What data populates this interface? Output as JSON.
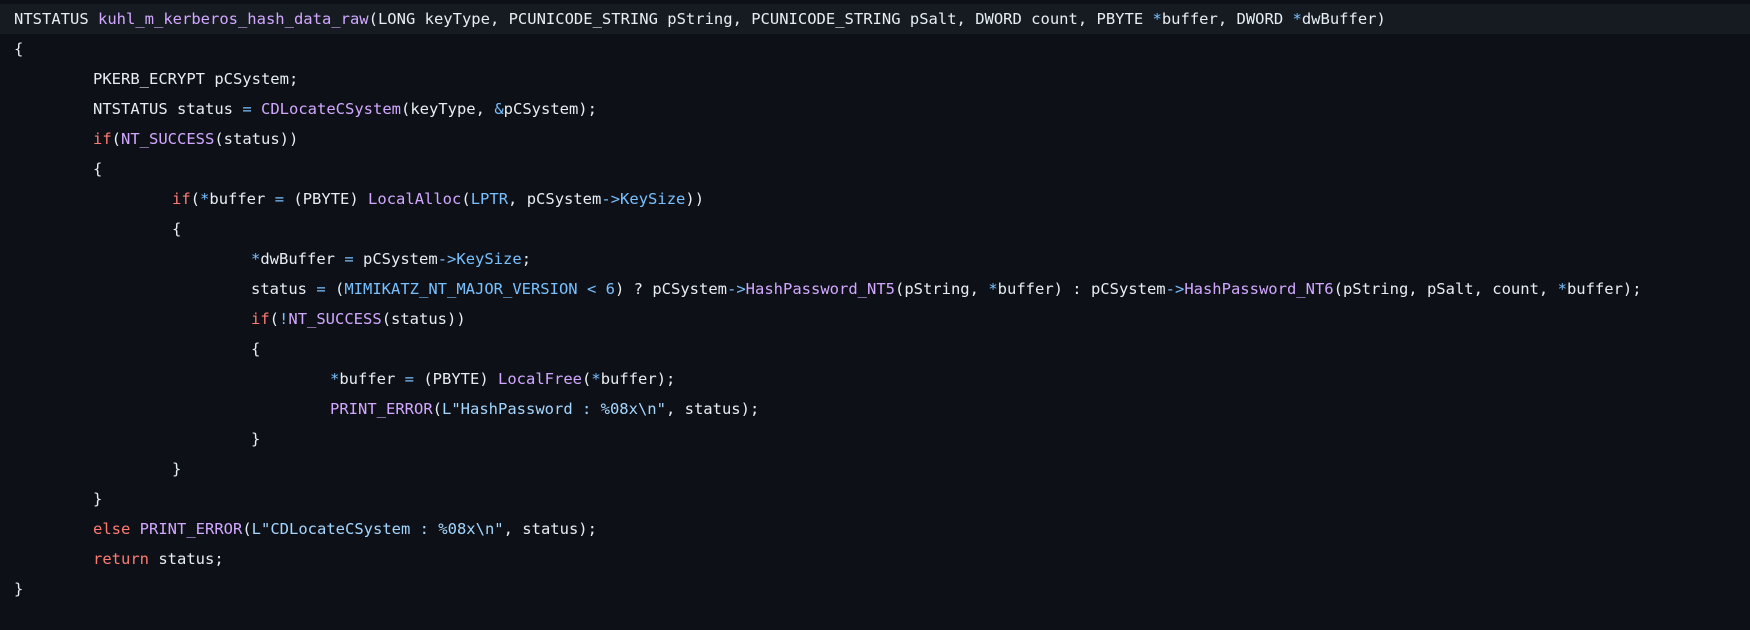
{
  "colors": {
    "background": "#0d1117",
    "highlight_line": "#161b22",
    "plain": "#e6edf3",
    "function": "#d2a8ff",
    "keyword": "#ff7b72",
    "operator": "#79c0ff",
    "constant": "#79c0ff",
    "string": "#a5d6ff",
    "member": "#79c0ff"
  },
  "code": {
    "lines": [
      {
        "indent": 0,
        "highlight": true,
        "tokens": [
          {
            "t": "NTSTATUS ",
            "c": "plain"
          },
          {
            "t": "kuhl_m_kerberos_hash_data_raw",
            "c": "function"
          },
          {
            "t": "(LONG keyType, PCUNICODE_STRING pString, PCUNICODE_STRING pSalt, DWORD count, PBYTE ",
            "c": "plain"
          },
          {
            "t": "*",
            "c": "operator"
          },
          {
            "t": "buffer, DWORD ",
            "c": "plain"
          },
          {
            "t": "*",
            "c": "operator"
          },
          {
            "t": "dwBuffer)",
            "c": "plain"
          }
        ]
      },
      {
        "indent": 0,
        "tokens": [
          {
            "t": "{",
            "c": "plain"
          }
        ]
      },
      {
        "indent": 1,
        "tokens": [
          {
            "t": "PKERB_ECRYPT pCSystem;",
            "c": "plain"
          }
        ]
      },
      {
        "indent": 1,
        "tokens": [
          {
            "t": "NTSTATUS status ",
            "c": "plain"
          },
          {
            "t": "=",
            "c": "operator"
          },
          {
            "t": " ",
            "c": "plain"
          },
          {
            "t": "CDLocateCSystem",
            "c": "function"
          },
          {
            "t": "(keyType, ",
            "c": "plain"
          },
          {
            "t": "&",
            "c": "operator"
          },
          {
            "t": "pCSystem);",
            "c": "plain"
          }
        ]
      },
      {
        "indent": 1,
        "tokens": [
          {
            "t": "if",
            "c": "keyword"
          },
          {
            "t": "(",
            "c": "plain"
          },
          {
            "t": "NT_SUCCESS",
            "c": "function"
          },
          {
            "t": "(status))",
            "c": "plain"
          }
        ]
      },
      {
        "indent": 1,
        "tokens": [
          {
            "t": "{",
            "c": "plain"
          }
        ]
      },
      {
        "indent": 2,
        "tokens": [
          {
            "t": "if",
            "c": "keyword"
          },
          {
            "t": "(",
            "c": "plain"
          },
          {
            "t": "*",
            "c": "operator"
          },
          {
            "t": "buffer ",
            "c": "plain"
          },
          {
            "t": "=",
            "c": "operator"
          },
          {
            "t": " (PBYTE) ",
            "c": "plain"
          },
          {
            "t": "LocalAlloc",
            "c": "function"
          },
          {
            "t": "(",
            "c": "plain"
          },
          {
            "t": "LPTR",
            "c": "const"
          },
          {
            "t": ", pCSystem",
            "c": "plain"
          },
          {
            "t": "->",
            "c": "operator"
          },
          {
            "t": "KeySize",
            "c": "member"
          },
          {
            "t": "))",
            "c": "plain"
          }
        ]
      },
      {
        "indent": 2,
        "tokens": [
          {
            "t": "{",
            "c": "plain"
          }
        ]
      },
      {
        "indent": 3,
        "tokens": [
          {
            "t": "*",
            "c": "operator"
          },
          {
            "t": "dwBuffer ",
            "c": "plain"
          },
          {
            "t": "=",
            "c": "operator"
          },
          {
            "t": " pCSystem",
            "c": "plain"
          },
          {
            "t": "->",
            "c": "operator"
          },
          {
            "t": "KeySize",
            "c": "member"
          },
          {
            "t": ";",
            "c": "plain"
          }
        ]
      },
      {
        "indent": 3,
        "tokens": [
          {
            "t": "status ",
            "c": "plain"
          },
          {
            "t": "=",
            "c": "operator"
          },
          {
            "t": " (",
            "c": "plain"
          },
          {
            "t": "MIMIKATZ_NT_MAJOR_VERSION",
            "c": "const"
          },
          {
            "t": " ",
            "c": "plain"
          },
          {
            "t": "<",
            "c": "operator"
          },
          {
            "t": " ",
            "c": "plain"
          },
          {
            "t": "6",
            "c": "const"
          },
          {
            "t": ") ? pCSystem",
            "c": "plain"
          },
          {
            "t": "->",
            "c": "operator"
          },
          {
            "t": "HashPassword_NT5",
            "c": "function"
          },
          {
            "t": "(pString, ",
            "c": "plain"
          },
          {
            "t": "*",
            "c": "operator"
          },
          {
            "t": "buffer) : pCSystem",
            "c": "plain"
          },
          {
            "t": "->",
            "c": "operator"
          },
          {
            "t": "HashPassword_NT6",
            "c": "function"
          },
          {
            "t": "(pString, pSalt, count, ",
            "c": "plain"
          },
          {
            "t": "*",
            "c": "operator"
          },
          {
            "t": "buffer);",
            "c": "plain"
          }
        ]
      },
      {
        "indent": 3,
        "tokens": [
          {
            "t": "if",
            "c": "keyword"
          },
          {
            "t": "(",
            "c": "plain"
          },
          {
            "t": "!",
            "c": "operator"
          },
          {
            "t": "NT_SUCCESS",
            "c": "function"
          },
          {
            "t": "(status))",
            "c": "plain"
          }
        ]
      },
      {
        "indent": 3,
        "tokens": [
          {
            "t": "{",
            "c": "plain"
          }
        ]
      },
      {
        "indent": 4,
        "tokens": [
          {
            "t": "*",
            "c": "operator"
          },
          {
            "t": "buffer ",
            "c": "plain"
          },
          {
            "t": "=",
            "c": "operator"
          },
          {
            "t": " (PBYTE) ",
            "c": "plain"
          },
          {
            "t": "LocalFree",
            "c": "function"
          },
          {
            "t": "(",
            "c": "plain"
          },
          {
            "t": "*",
            "c": "operator"
          },
          {
            "t": "buffer);",
            "c": "plain"
          }
        ]
      },
      {
        "indent": 4,
        "tokens": [
          {
            "t": "PRINT_ERROR",
            "c": "function"
          },
          {
            "t": "(",
            "c": "plain"
          },
          {
            "t": "L\"HashPassword : %08x\\n\"",
            "c": "string"
          },
          {
            "t": ", status);",
            "c": "plain"
          }
        ]
      },
      {
        "indent": 3,
        "tokens": [
          {
            "t": "}",
            "c": "plain"
          }
        ]
      },
      {
        "indent": 2,
        "tokens": [
          {
            "t": "}",
            "c": "plain"
          }
        ]
      },
      {
        "indent": 1,
        "tokens": [
          {
            "t": "}",
            "c": "plain"
          }
        ]
      },
      {
        "indent": 1,
        "tokens": [
          {
            "t": "else",
            "c": "keyword"
          },
          {
            "t": " ",
            "c": "plain"
          },
          {
            "t": "PRINT_ERROR",
            "c": "function"
          },
          {
            "t": "(",
            "c": "plain"
          },
          {
            "t": "L\"CDLocateCSystem : %08x\\n\"",
            "c": "string"
          },
          {
            "t": ", status);",
            "c": "plain"
          }
        ]
      },
      {
        "indent": 1,
        "tokens": [
          {
            "t": "return",
            "c": "keyword"
          },
          {
            "t": " status;",
            "c": "plain"
          }
        ]
      },
      {
        "indent": 0,
        "tokens": [
          {
            "t": "}",
            "c": "plain"
          }
        ]
      }
    ]
  }
}
